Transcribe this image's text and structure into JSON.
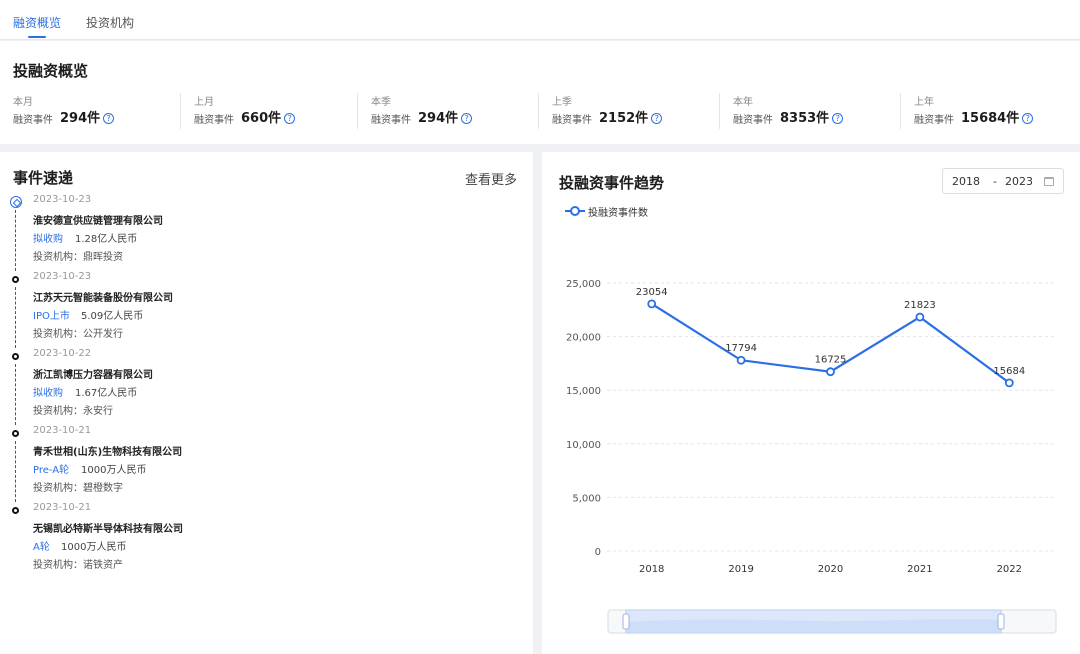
{
  "tabs": [
    {
      "label": "融资概览",
      "active": true
    },
    {
      "label": "投资机构",
      "active": false
    }
  ],
  "overview": {
    "title": "投融资概览",
    "stats": [
      {
        "period": "本月",
        "label": "融资事件",
        "value": "294件"
      },
      {
        "period": "上月",
        "label": "融资事件",
        "value": "660件"
      },
      {
        "period": "本季",
        "label": "融资事件",
        "value": "294件"
      },
      {
        "period": "上季",
        "label": "融资事件",
        "value": "2152件"
      },
      {
        "period": "本年",
        "label": "融资事件",
        "value": "8353件"
      },
      {
        "period": "上年",
        "label": "融资事件",
        "value": "15684件"
      }
    ]
  },
  "events": {
    "title": "事件速递",
    "more": "查看更多",
    "items": [
      {
        "date": "2023-10-23",
        "company": "淮安德宣供应链管理有限公司",
        "round": "拟收购",
        "amount": "1.28亿人民币",
        "investor": "投资机构：鼎晖投资"
      },
      {
        "date": "2023-10-23",
        "company": "江苏天元智能装备股份有限公司",
        "round": "IPO上市",
        "amount": "5.09亿人民币",
        "investor": "投资机构：公开发行"
      },
      {
        "date": "2023-10-22",
        "company": "浙江凯博压力容器有限公司",
        "round": "拟收购",
        "amount": "1.67亿人民币",
        "investor": "投资机构：永安行"
      },
      {
        "date": "2023-10-21",
        "company": "青禾世相(山东)生物科技有限公司",
        "round": "Pre-A轮",
        "amount": "1000万人民币",
        "investor": "投资机构：碧橙数字"
      },
      {
        "date": "2023-10-21",
        "company": "无锡凯必特斯半导体科技有限公司",
        "round": "A轮",
        "amount": "1000万人民币",
        "investor": "投资机构：诺铁资产"
      }
    ]
  },
  "trend": {
    "title": "投融资事件趋势",
    "range_start": "2018",
    "range_sep": "-",
    "range_end": "2023",
    "calendar_icon": "calendar-icon",
    "accent": "#2b6fe6"
  },
  "chart_data": {
    "type": "line",
    "title": "投融资事件趋势",
    "x": [
      "2018",
      "2019",
      "2020",
      "2021",
      "2022"
    ],
    "series": [
      {
        "name": "投融资事件数",
        "values": [
          23054,
          17794,
          16725,
          21823,
          15684
        ]
      }
    ],
    "ylim": [
      0,
      25000
    ],
    "yticks": [
      0,
      5000,
      10000,
      15000,
      20000,
      25000
    ],
    "ytick_labels": [
      "0",
      "5,000",
      "10,000",
      "15,000",
      "20,000",
      "25,000"
    ],
    "data_labels": [
      "23054",
      "17794",
      "16725",
      "21823",
      "15684"
    ],
    "grid": true,
    "legend": "top-left",
    "color": "#2b6fe6"
  }
}
